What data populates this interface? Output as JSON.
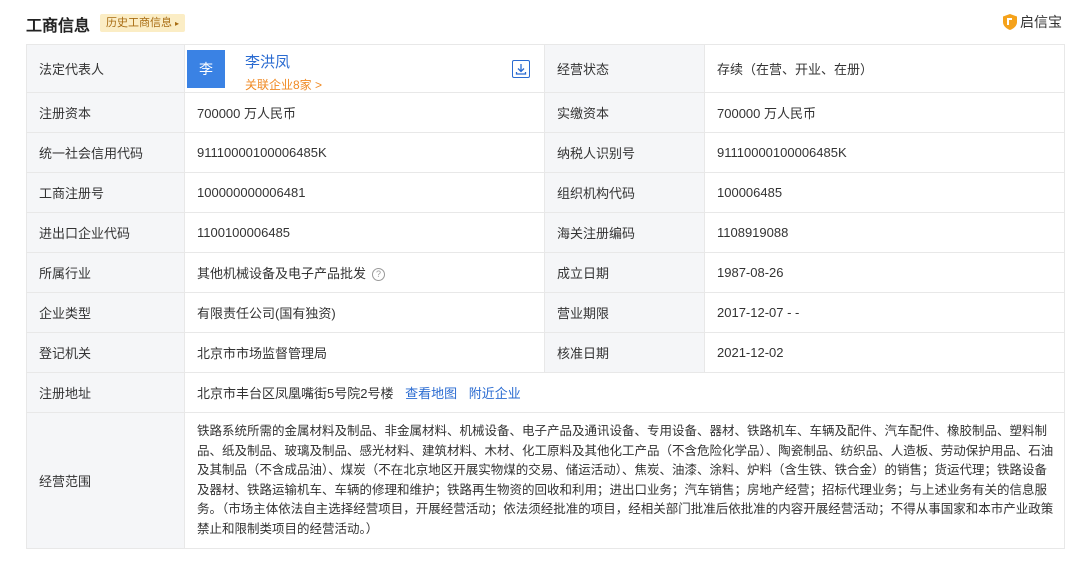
{
  "header": {
    "title": "工商信息",
    "history_tag": "历史工商信息",
    "history_caret": "▸",
    "brand": "启信宝"
  },
  "legal_rep": {
    "label": "法定代表人",
    "avatar_char": "李",
    "name": "李洪凤",
    "related": "关联企业8家 >",
    "status_label": "经营状态",
    "status_value": "存续（在营、开业、在册）"
  },
  "rows": [
    {
      "l1": "注册资本",
      "v1": "700000 万人民币",
      "l2": "实缴资本",
      "v2": "700000 万人民币"
    },
    {
      "l1": "统一社会信用代码",
      "v1": "91110000100006485K",
      "l2": "纳税人识别号",
      "v2": "91110000100006485K"
    },
    {
      "l1": "工商注册号",
      "v1": "100000000006481",
      "l2": "组织机构代码",
      "v2": "100006485"
    },
    {
      "l1": "进出口企业代码",
      "v1": "1100100006485",
      "l2": "海关注册编码",
      "v2": "1108919088"
    },
    {
      "l1": "所属行业",
      "v1": "其他机械设备及电子产品批发",
      "l2": "成立日期",
      "v2": "1987-08-26"
    },
    {
      "l1": "企业类型",
      "v1": "有限责任公司(国有独资)",
      "l2": "营业期限",
      "v2": "2017-12-07 - -"
    },
    {
      "l1": "登记机关",
      "v1": "北京市市场监督管理局",
      "l2": "核准日期",
      "v2": "2021-12-02"
    }
  ],
  "address": {
    "label": "注册地址",
    "value": "北京市丰台区凤凰嘴街5号院2号楼",
    "map_link": "查看地图",
    "nearby_link": "附近企业"
  },
  "scope": {
    "label": "经营范围",
    "value": "铁路系统所需的金属材料及制品、非金属材料、机械设备、电子产品及通讯设备、专用设备、器材、铁路机车、车辆及配件、汽车配件、橡胶制品、塑料制品、纸及制品、玻璃及制品、感光材料、建筑材料、木材、化工原料及其他化工产品（不含危险化学品）、陶瓷制品、纺织品、人造板、劳动保护用品、石油及其制品（不含成品油）、煤炭（不在北京地区开展实物煤的交易、储运活动）、焦炭、油漆、涂料、炉料（含生铁、铁合金）的销售；货运代理；铁路设备及器材、铁路运输机车、车辆的修理和维护；铁路再生物资的回收和利用；进出口业务；汽车销售；房地产经营；招标代理业务；与上述业务有关的信息服务。（市场主体依法自主选择经营项目，开展经营活动；依法须经批准的项目，经相关部门批准后依批准的内容开展经营活动；不得从事国家和本市产业政策禁止和限制类项目的经营活动。）"
  },
  "icons": {
    "brand": "shield-logo-icon",
    "download": "download-icon",
    "help": "question-circle-icon"
  },
  "colors": {
    "accent": "#2a6bd1",
    "orange": "#f08a24",
    "avatar_bg": "#3a82e4",
    "tag_bg": "#fbedc5",
    "label_bg": "#f5f6f8"
  }
}
